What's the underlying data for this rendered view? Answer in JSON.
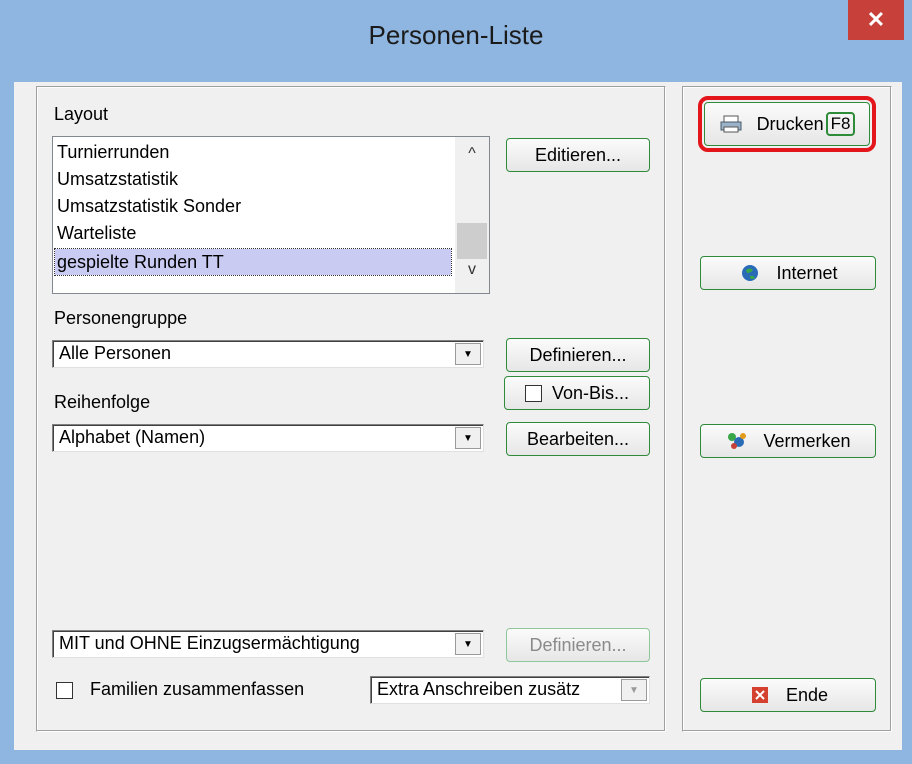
{
  "window": {
    "title": "Personen-Liste",
    "close_glyph": "✕"
  },
  "layout": {
    "label": "Layout",
    "items": [
      "Turnierrunden",
      "Umsatzstatistik",
      "Umsatzstatistik Sonder",
      "Warteliste",
      "gespielte Runden TT"
    ],
    "selected_index": 4,
    "scroll_up": "^",
    "scroll_down": "v",
    "edit_button": "Editieren..."
  },
  "personengruppe": {
    "label": "Personengruppe",
    "value": "Alle Personen",
    "define_button": "Definieren...",
    "von_bis_button": "Von-Bis..."
  },
  "reihenfolge": {
    "label": "Reihenfolge",
    "value": "Alphabet (Namen)",
    "edit_button": "Bearbeiten..."
  },
  "einzug": {
    "value": "MIT und OHNE Einzugsermächtigung",
    "define_button": "Definieren..."
  },
  "familien": {
    "label": "Familien zusammenfassen",
    "checked": false
  },
  "extra": {
    "value": "Extra Anschreiben zusätz"
  },
  "actions": {
    "drucken": {
      "label": "Drucken",
      "shortcut": "F8",
      "icon": "printer-icon"
    },
    "internet": {
      "label": "Internet",
      "icon": "globe-icon"
    },
    "vermerken": {
      "label": "Vermerken",
      "icon": "notes-icon"
    },
    "ende": {
      "label": "Ende",
      "icon": "close-red-icon"
    }
  },
  "colors": {
    "highlight": "#e3161b",
    "button_border": "#2e8b3a",
    "selection": "#c9cbf2"
  }
}
